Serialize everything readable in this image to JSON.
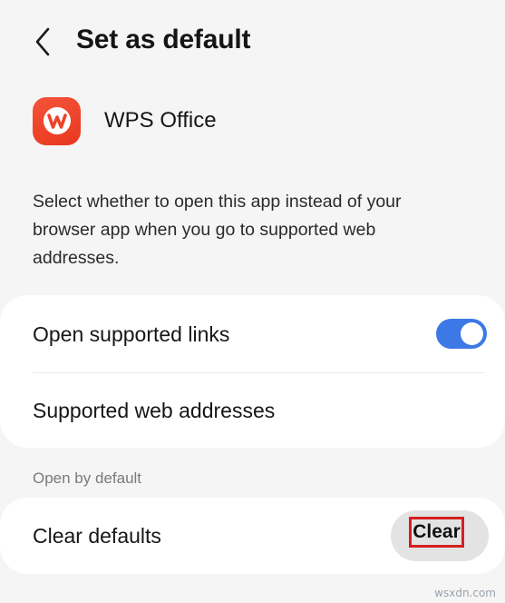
{
  "header": {
    "title": "Set as default",
    "back_icon": "chevron-left-icon"
  },
  "app": {
    "name": "WPS Office",
    "icon": "wps-office-logo",
    "icon_color": "#ee432a"
  },
  "description": "Select whether to open this app instead of your browser app when you go to supported web addresses.",
  "links_card": {
    "open_supported_links": {
      "label": "Open supported links",
      "toggle_on": true,
      "toggle_color": "#3c79e6"
    },
    "supported_web_addresses": {
      "label": "Supported web addresses"
    }
  },
  "open_by_default": {
    "section_label": "Open by default",
    "clear_defaults_label": "Clear defaults",
    "clear_button_label": "Clear",
    "highlight_color": "#d42020"
  },
  "watermark": "wsxdn.com"
}
